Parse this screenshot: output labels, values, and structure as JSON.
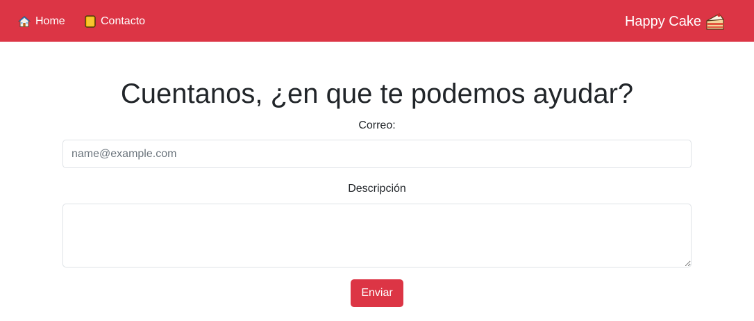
{
  "navbar": {
    "color": "#dc3545",
    "links": [
      {
        "label": "Home",
        "icon": "house-icon"
      },
      {
        "label": "Contacto",
        "icon": "book-icon"
      }
    ],
    "brand": {
      "label": "Happy Cake",
      "icon": "cake-icon"
    }
  },
  "main": {
    "title": "Cuentanos, ¿en que te podemos ayudar?",
    "email": {
      "label": "Correo:",
      "placeholder": "name@example.com",
      "value": ""
    },
    "description": {
      "label": "Descripción",
      "value": ""
    },
    "submit_label": "Enviar"
  }
}
